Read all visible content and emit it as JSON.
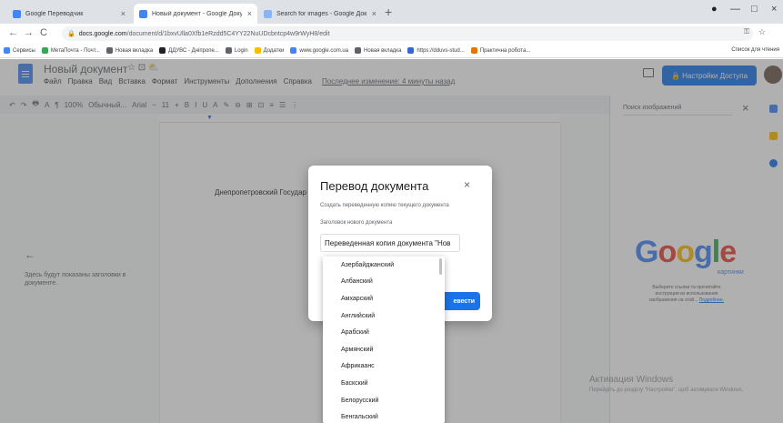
{
  "browser": {
    "tabs": [
      {
        "title": "Google Переводчик",
        "favicon_color": "#4285f4",
        "active": false
      },
      {
        "title": "Новый документ - Google Доку",
        "favicon_color": "#4285f4",
        "active": true
      },
      {
        "title": "Search for images - Google Док",
        "favicon_color": "#8ab4f8",
        "active": false
      }
    ],
    "tab_close": "×",
    "new_tab": "+",
    "window_controls": {
      "profile": "●",
      "minimize": "—",
      "maximize": "□",
      "close": "×"
    },
    "nav": {
      "back": "←",
      "forward": "→",
      "reload": "C"
    },
    "url": {
      "lock": "🔒",
      "host": "docs.google.com",
      "path": "/document/d/1bxvUlla0Xfb1eRzdd5C4YY22NuUDcbntcp4w9rWyH8/edit"
    },
    "url_right": {
      "key": "⚿",
      "star": "☆"
    },
    "bookmarks": [
      {
        "label": "Сервисы",
        "color": "#4285f4"
      },
      {
        "label": "МетаПочта - Почт...",
        "color": "#34a853"
      },
      {
        "label": "Новая вкладка",
        "color": "#5f6368"
      },
      {
        "label": "ДДУВС - Дніпропе...",
        "color": "#202124"
      },
      {
        "label": "Login",
        "color": "#5f6368"
      },
      {
        "label": "Додатки",
        "color": "#fbbc04"
      },
      {
        "label": "www.google.com.ua",
        "color": "#4285f4"
      },
      {
        "label": "Новая вкладка",
        "color": "#5f6368"
      },
      {
        "label": "https://dduvs-stud...",
        "color": "#3367d6"
      },
      {
        "label": "Практична робота...",
        "color": "#e37400"
      }
    ],
    "bookmarks_right": "Список для чтения"
  },
  "docs": {
    "title": "Новый документ",
    "title_icons": "☆ ⊡ ⛅",
    "menu": [
      "Файл",
      "Правка",
      "Вид",
      "Вставка",
      "Формат",
      "Инструменты",
      "Дополнения",
      "Справка"
    ],
    "last_edit": "Последнее изменение: 4 минуты назад",
    "share_label": "🔒 Настройки Доступа",
    "toolbar": [
      "↶",
      "↷",
      "🖶",
      "A",
      "¶",
      "100%",
      "Обычный...",
      "Arial",
      "−",
      "11",
      "+",
      "B",
      "I",
      "U",
      "A",
      "✎",
      "⊖",
      "⊞",
      "⊡",
      "≡",
      "☰",
      "⋮"
    ],
    "page_heading": "Днепропетровский Государ",
    "outline_back": "←",
    "outline_hint": "Здесь будут показаны заголовки в документе."
  },
  "side_panel": {
    "search_placeholder": "Поиск изображений",
    "close": "×",
    "google_letters": [
      {
        "ch": "G",
        "color": "#4285f4"
      },
      {
        "ch": "o",
        "color": "#ea4335"
      },
      {
        "ch": "o",
        "color": "#fbbc04"
      },
      {
        "ch": "g",
        "color": "#4285f4"
      },
      {
        "ch": "l",
        "color": "#34a853"
      },
      {
        "ch": "e",
        "color": "#ea4335"
      }
    ],
    "google_sub": "картинки",
    "desc_text": "Выберите ссылки та прочитайте инструкции из использования изображения на этой...",
    "desc_link": "Подробнее."
  },
  "windows_activation": {
    "line1": "Активация Windows",
    "line2": "Перейдіть до розділу \"Настройки\", щоб активувати Windows."
  },
  "dialog": {
    "title": "Перевод документа",
    "close": "×",
    "description": "Создать переведенную копию текущего документа",
    "field_label": "Заголовок нового документа",
    "field_value": "Переведенная копия документа \"Нов",
    "confirm_label": "евести"
  },
  "languages": [
    "Азербайджанский",
    "Албанский",
    "Амхарский",
    "Английский",
    "Арабский",
    "Армянский",
    "Африкаанс",
    "Баскский",
    "Белорусский",
    "Бенгальский"
  ]
}
